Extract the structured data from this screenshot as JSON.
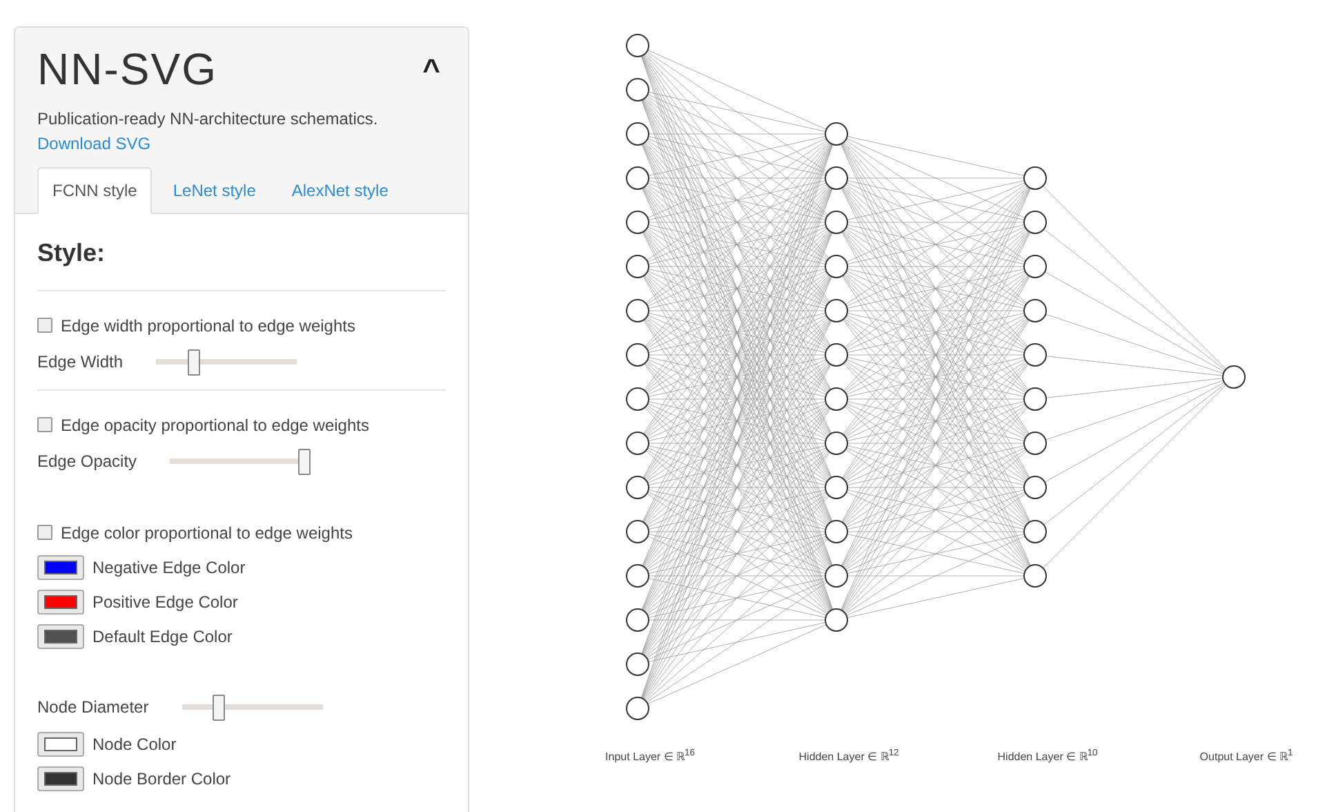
{
  "panel": {
    "title": "NN-SVG",
    "subtitle": "Publication-ready NN-architecture schematics.",
    "download_link": "Download SVG",
    "collapse_glyph": "^"
  },
  "tabs": [
    {
      "label": "FCNN style",
      "selected": true
    },
    {
      "label": "LeNet style",
      "selected": false
    },
    {
      "label": "AlexNet style",
      "selected": false
    }
  ],
  "section_title": "Style:",
  "controls": [
    {
      "kind": "checkbox",
      "label": "Edge width proportional to edge weights",
      "checked": false
    },
    {
      "kind": "slider",
      "label": "Edge Width",
      "level": 0.27
    },
    {
      "kind": "divider"
    },
    {
      "kind": "checkbox",
      "label": "Edge opacity proportional to edge weights",
      "checked": false
    },
    {
      "kind": "slider",
      "label": "Edge Opacity",
      "level": 0.97
    },
    {
      "kind": "spacer"
    },
    {
      "kind": "checkbox",
      "label": "Edge color proportional to edge weights",
      "checked": false
    },
    {
      "kind": "color",
      "label": "Negative Edge Color",
      "color": "#0000ff"
    },
    {
      "kind": "color",
      "label": "Positive Edge Color",
      "color": "#ff0000"
    },
    {
      "kind": "color",
      "label": "Default Edge Color",
      "color": "#505050"
    },
    {
      "kind": "spacer"
    },
    {
      "kind": "slider",
      "label": "Node Diameter",
      "level": 0.26
    },
    {
      "kind": "color",
      "label": "Node Color",
      "color": "#ffffff"
    },
    {
      "kind": "color",
      "label": "Node Border Color",
      "color": "#333333"
    }
  ],
  "layer_labels": [
    "Input Layer ∈ ℝ$^{16}$",
    "Hidden Layer ∈ ℝ$^{12}$",
    "Hidden Layer ∈ ℝ$^{10}$",
    "Output Layer ∈ ℝ$^{1}$"
  ]
}
